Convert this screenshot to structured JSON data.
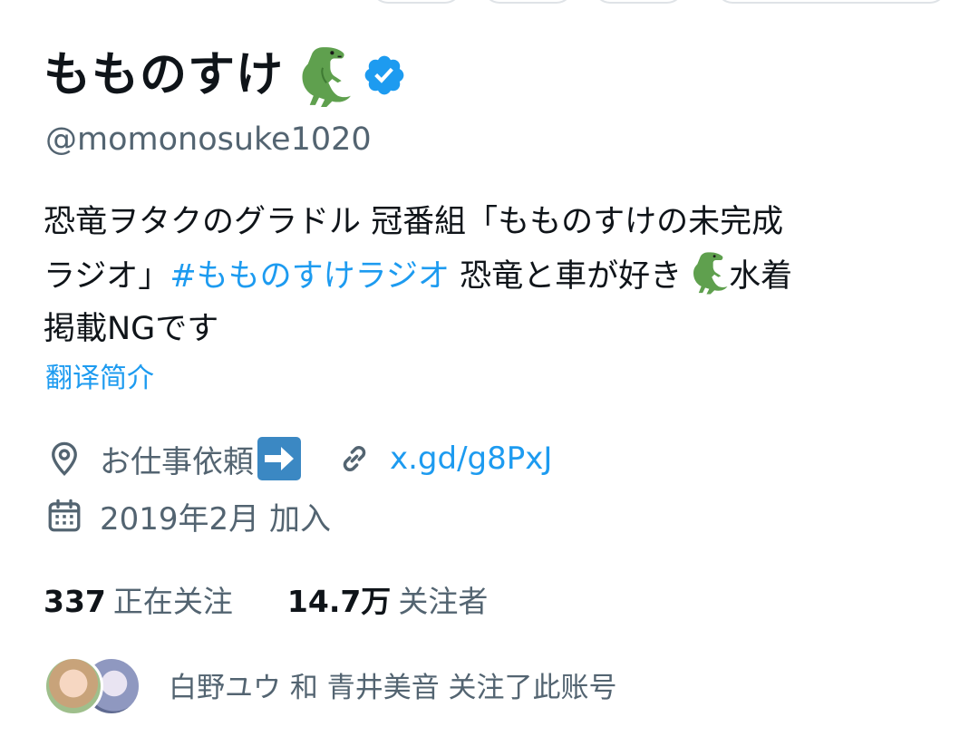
{
  "profile": {
    "name": "もものすけ",
    "name_emoji": "dinosaur",
    "verified_icon": "verified-badge-icon",
    "handle": "@momonosuke1020"
  },
  "bio": {
    "line1": "恐竜ヲタクのグラドル 冠番組「もものすけの未完成",
    "line2_prefix": "ラジオ」",
    "hashtag": "#もものすけラジオ",
    "line2_mid": " 恐竜と車が好き",
    "line2_suffix": "水着",
    "line3": "掲載NGです"
  },
  "translate_label": "翻译简介",
  "meta": {
    "location": "お仕事依頼",
    "location_emoji": "right-arrow-emoji",
    "link": "x.gd/g8PxJ",
    "joined": "2019年2月 加入"
  },
  "stats": {
    "following_count": "337",
    "following_label": "正在关注",
    "followers_count": "14.7万",
    "followers_label": "关注者"
  },
  "followed_by": "白野ユウ 和 青井美音 关注了此账号",
  "colors": {
    "accent": "#1d9bf0",
    "secondary_text": "#536471",
    "primary_text": "#0f1419",
    "emoji_arrow_bg": "#3b88c3",
    "dinosaur_green": "#5fa04e"
  }
}
